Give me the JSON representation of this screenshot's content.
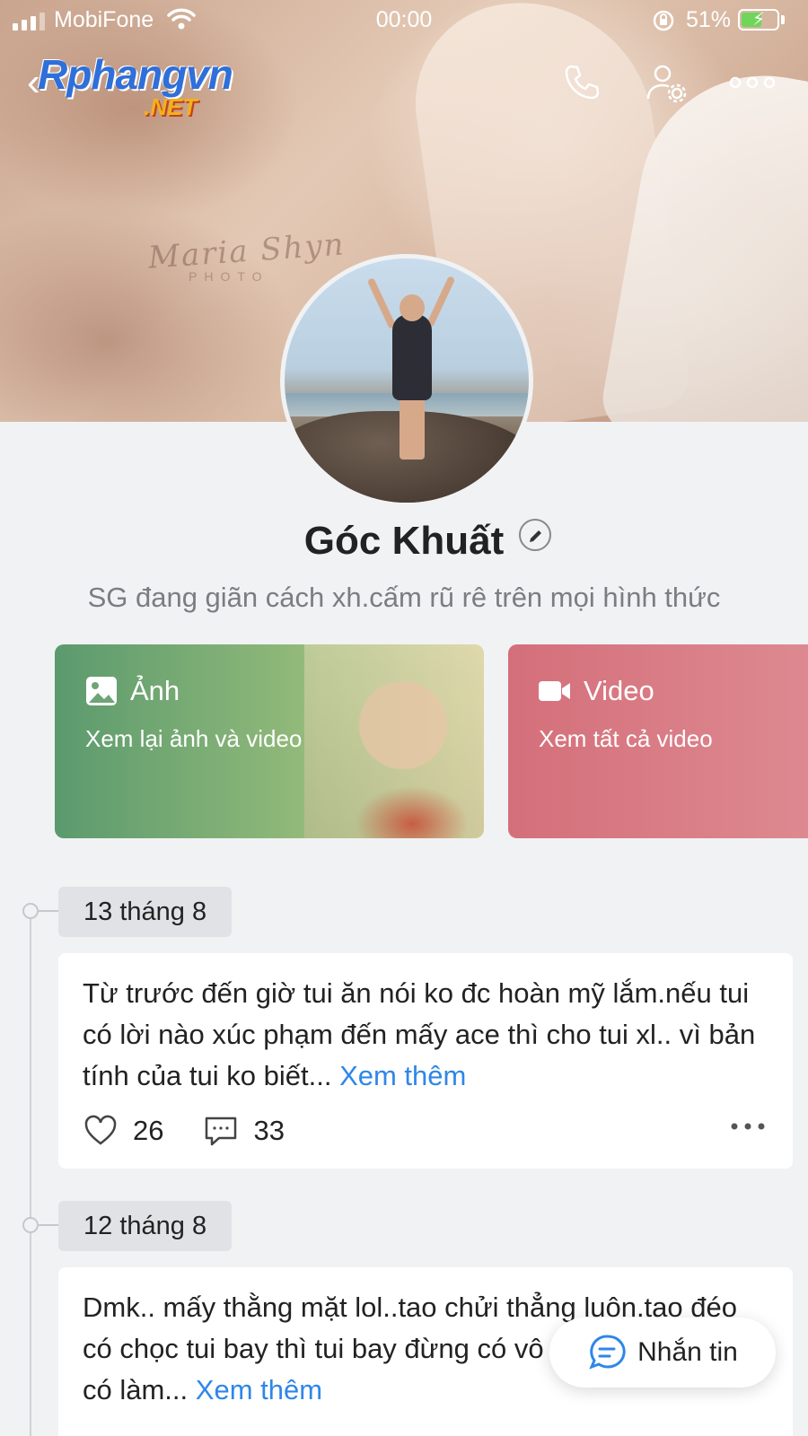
{
  "status_bar": {
    "carrier": "MobiFone",
    "time": "00:00",
    "battery": "51%"
  },
  "header": {
    "back_icon": "chevron-left-icon",
    "logo_text": "Rphangvn",
    "logo_suffix": ".NET",
    "actions": [
      "phone-icon",
      "user-settings-icon",
      "more-icon"
    ]
  },
  "cover": {
    "watermark": "Maria Shyn",
    "watermark_sub": "PHOTO"
  },
  "profile": {
    "name": "Góc Khuất",
    "bio": "SG đang giãn cách xh.cấm rũ rê trên mọi hình thức"
  },
  "media": {
    "photos": {
      "title": "Ảnh",
      "subtitle": "Xem lại ảnh và video"
    },
    "videos": {
      "title": "Video",
      "subtitle": "Xem tất cả video"
    }
  },
  "posts": [
    {
      "date": "13 tháng 8",
      "text": "Từ trước đến giờ tui ăn nói ko đc hoàn mỹ lắm.nếu tui có lời nào xúc phạm đến mấy ace thì cho tui xl.. vì bản tính của tui ko biết...",
      "more": "Xem thêm",
      "likes": "26",
      "comments": "33"
    },
    {
      "date": "12 tháng 8",
      "text": "Dmk.. mấy thằng mặt lol..tao chửi thẳng luôn.tao đéo có chọc tui bay thì tui bay đừng có vô cà khịa tao...tao có làm...",
      "more": "Xem thêm"
    }
  ],
  "fab": {
    "label": "Nhắn tin"
  },
  "colors": {
    "accent": "#2f86e8",
    "photo_card": "#5b9a6e",
    "video_card": "#d46f7a",
    "background": "#f1f2f4"
  }
}
